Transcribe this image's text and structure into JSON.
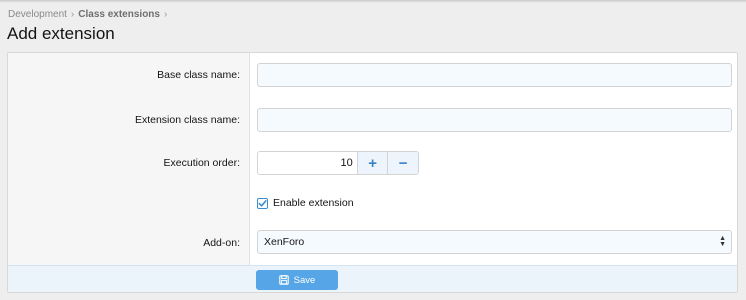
{
  "breadcrumb": {
    "items": [
      "Development",
      "Class extensions"
    ],
    "separator": "›"
  },
  "page": {
    "title": "Add extension"
  },
  "form": {
    "base_class": {
      "label": "Base class name:",
      "value": ""
    },
    "extension_class": {
      "label": "Extension class name:",
      "value": ""
    },
    "execution_order": {
      "label": "Execution order:",
      "value": "10",
      "plus": "+",
      "minus": "−"
    },
    "enable": {
      "label": "Enable extension",
      "checked": true
    },
    "addon": {
      "label": "Add-on:",
      "selected": "XenForo",
      "arrows": {
        "up": "▲",
        "down": "▼"
      }
    }
  },
  "footer": {
    "save_label": "Save"
  },
  "colors": {
    "accent": "#56a5e6",
    "footer_bg": "#ebf3fb",
    "label_bg": "#f6f6f6"
  }
}
